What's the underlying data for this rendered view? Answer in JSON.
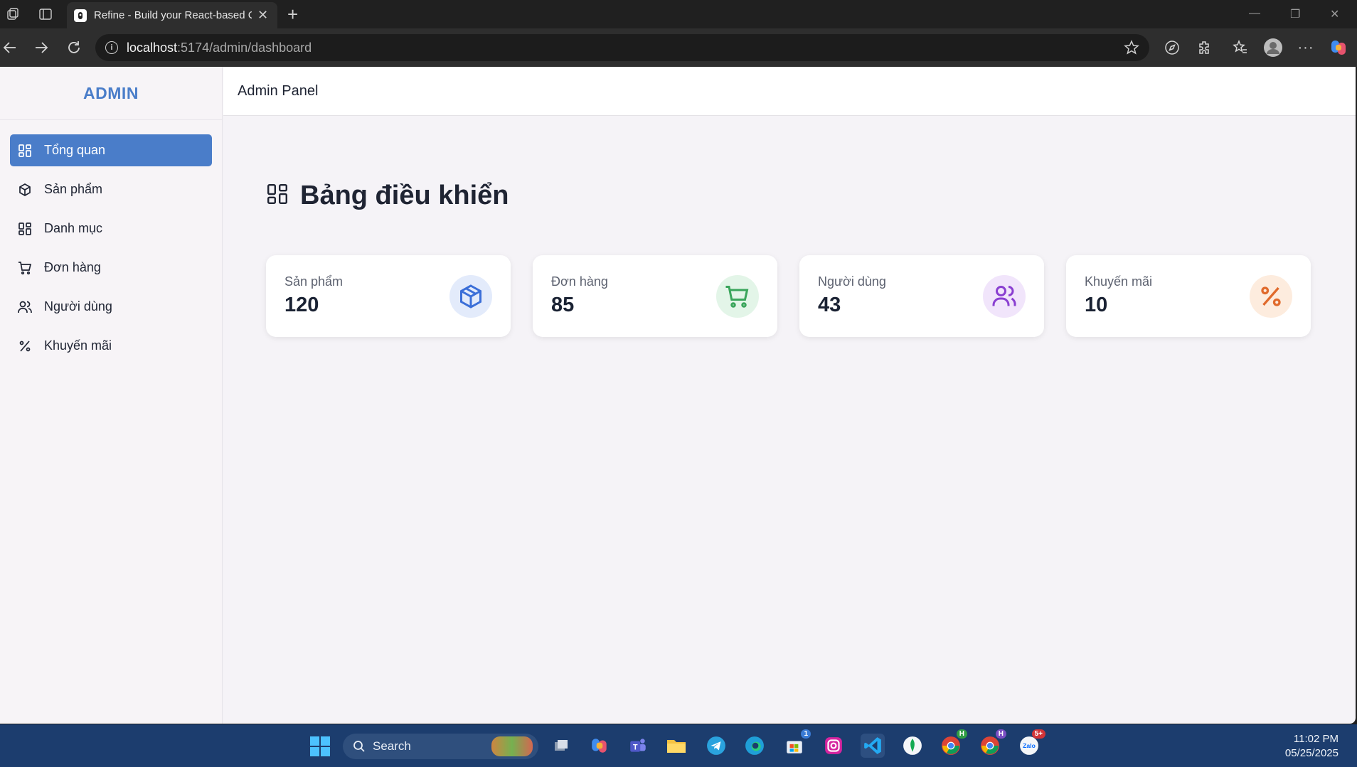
{
  "browser": {
    "tab_title": "Refine - Build your React-based C",
    "url_host": "localhost",
    "url_path": ":5174/admin/dashboard"
  },
  "sidebar": {
    "brand": "ADMIN",
    "items": [
      {
        "label": "Tổng quan",
        "icon": "grid-icon",
        "active": true
      },
      {
        "label": "Sản phẩm",
        "icon": "box-icon"
      },
      {
        "label": "Danh mục",
        "icon": "grid-icon"
      },
      {
        "label": "Đơn hàng",
        "icon": "cart-icon"
      },
      {
        "label": "Người dùng",
        "icon": "users-icon"
      },
      {
        "label": "Khuyến mãi",
        "icon": "percent-icon"
      }
    ]
  },
  "header": {
    "title": "Admin Panel"
  },
  "main": {
    "title": "Bảng điều khiển",
    "stats": [
      {
        "label": "Sản phẩm",
        "value": "120",
        "icon": "box-icon",
        "color": "#3b6fd8",
        "bg": "#e3ebfb"
      },
      {
        "label": "Đơn hàng",
        "value": "85",
        "icon": "cart-icon",
        "color": "#3aa55b",
        "bg": "#e3f5e8"
      },
      {
        "label": "Người dùng",
        "value": "43",
        "icon": "users-icon",
        "color": "#8a3fd1",
        "bg": "#f1e5fb"
      },
      {
        "label": "Khuyến mãi",
        "value": "10",
        "icon": "percent-icon",
        "color": "#e06a2c",
        "bg": "#fdecde"
      }
    ]
  },
  "taskbar": {
    "search_label": "Search",
    "time": "11:02 PM",
    "date": "05/25/2025",
    "store_badge": "1",
    "zalo_badge": "5+",
    "zalo_label": "Zalo",
    "chrome_badge": "H"
  }
}
